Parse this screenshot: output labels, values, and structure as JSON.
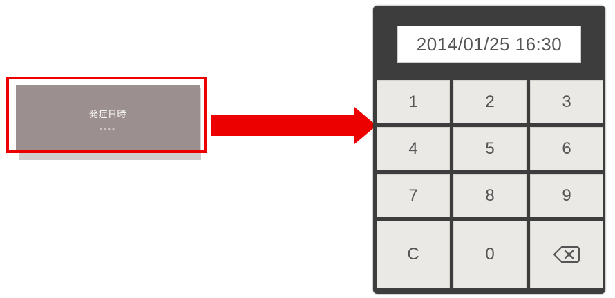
{
  "onset_card": {
    "title": "発症日時",
    "value": "----"
  },
  "keypad": {
    "display_value": "2014/01/25 16:30",
    "keys": [
      {
        "label": "1"
      },
      {
        "label": "2"
      },
      {
        "label": "3"
      },
      {
        "label": "4"
      },
      {
        "label": "5"
      },
      {
        "label": "6"
      },
      {
        "label": "7"
      },
      {
        "label": "8"
      },
      {
        "label": "9"
      },
      {
        "label": "C"
      },
      {
        "label": "0"
      },
      {
        "label": "",
        "icon": "backspace-icon"
      }
    ]
  },
  "colors": {
    "highlight": "#ec0000",
    "arrow": "#ec0000",
    "card_bg": "#9c8f8f",
    "panel_bg": "#3d3d3d",
    "key_bg": "#ebe9e5",
    "key_text": "#555555"
  }
}
